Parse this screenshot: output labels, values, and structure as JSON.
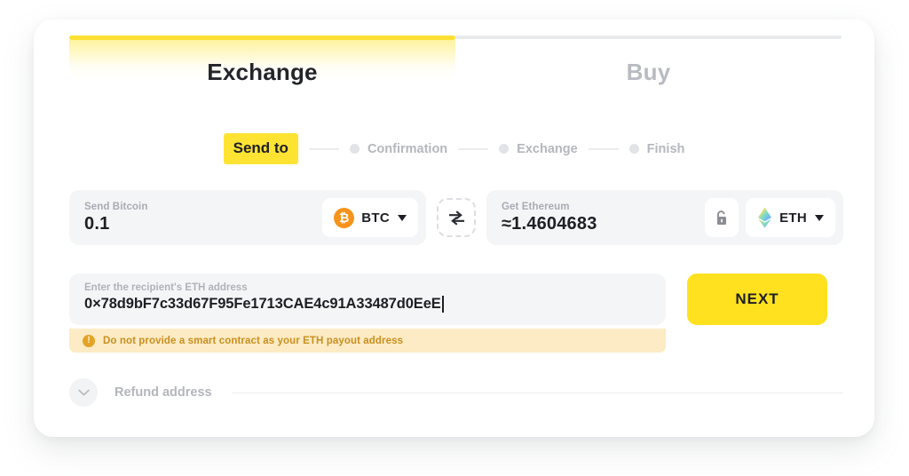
{
  "tabs": [
    {
      "label": "Exchange",
      "state": "active"
    },
    {
      "label": "Buy",
      "state": "inactive"
    }
  ],
  "steps": {
    "current": "Send to",
    "items": [
      {
        "label": "Send to",
        "active": true
      },
      {
        "label": "Confirmation",
        "active": false
      },
      {
        "label": "Exchange",
        "active": false
      },
      {
        "label": "Finish",
        "active": false
      }
    ]
  },
  "send": {
    "label": "Send Bitcoin",
    "value": "0.1",
    "currency": "BTC",
    "currency_icon": "bitcoin-icon",
    "caret": "chevron-down-icon"
  },
  "swap": {
    "icon": "swap-arrows-icon"
  },
  "get": {
    "label": "Get Ethereum",
    "value": "≈1.4604683",
    "currency": "ETH",
    "currency_icon": "ethereum-icon",
    "lock": "unlocked-padlock-icon"
  },
  "address": {
    "label": "Enter the recipient's ETH address",
    "value": "0×78d9bF7c33d67F95Fe1713CAE4c91A33487d0EeE",
    "placeholder": "Enter the recipient's ETH address"
  },
  "next": {
    "label": "NEXT"
  },
  "warning": {
    "icon": "exclamation-circle-icon",
    "text": "Do not provide a smart contract as your ETH payout address"
  },
  "refund": {
    "label": "Refund address",
    "toggle_icon": "chevron-down-icon"
  },
  "colors": {
    "accent_yellow": "#FFE333",
    "button_yellow": "#FFE120",
    "bitcoin_orange": "#F7931A",
    "warning_bg": "#FCEBC4",
    "warning_text": "#C98F20",
    "input_bg": "#F4F5F7",
    "text_dark": "#1D1F24",
    "text_muted": "#B5B7BE"
  }
}
